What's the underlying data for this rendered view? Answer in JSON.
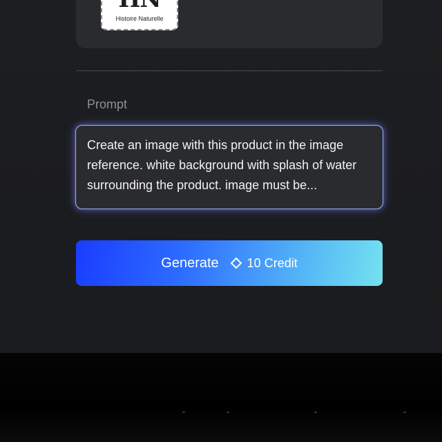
{
  "thumbnail": {
    "brand_mark": "HN",
    "brand_name": "Histoire Naturelle"
  },
  "prompt": {
    "label": "Prompt",
    "value": "Create an image with this product in the image reference. white background with splash of water surrounding the product. image must be..."
  },
  "generate_button": {
    "label": "Generate",
    "credit_icon": "diamond-icon",
    "credit_label": "10 Credit"
  },
  "colors": {
    "panel_bg": "#1d1e21",
    "card_bg": "#2a2b2e",
    "prompt_border": "#8fb0ff",
    "button_gradient_start": "#1a3dff",
    "button_gradient_end": "#74e2f0"
  }
}
